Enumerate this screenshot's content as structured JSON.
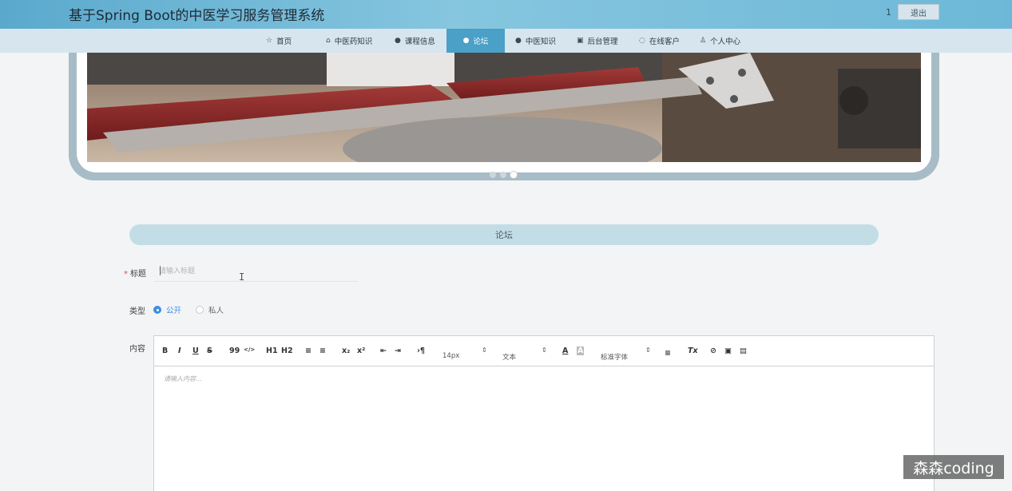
{
  "header": {
    "site_title": "基于Spring Boot的中医学习服务管理系统",
    "user_num": "1",
    "logout_label": "退出"
  },
  "nav": {
    "items": [
      {
        "label": "首页",
        "icon": "star-icon",
        "glyph": "☆"
      },
      {
        "label": "中医药知识",
        "icon": "bag-icon",
        "glyph": "⌂"
      },
      {
        "label": "课程信息",
        "icon": "info-icon",
        "glyph": "●"
      },
      {
        "label": "论坛",
        "icon": "question-icon",
        "glyph": "●"
      },
      {
        "label": "中医知识",
        "icon": "info-icon",
        "glyph": "●"
      },
      {
        "label": "后台管理",
        "icon": "briefcase-icon",
        "glyph": "▣"
      },
      {
        "label": "在线客户",
        "icon": "headset-icon",
        "glyph": "◌"
      },
      {
        "label": "个人中心",
        "icon": "user-icon",
        "glyph": "♙"
      }
    ],
    "active_index": 3
  },
  "carousel": {
    "slide_count": 3,
    "active_slide": 3
  },
  "section": {
    "title": "论坛"
  },
  "form": {
    "title_label": "标题",
    "required_mark": "*",
    "title_placeholder": "请输入标题",
    "type_label": "类型",
    "type_options": [
      "公开",
      "私人"
    ],
    "type_selected": "公开",
    "content_label": "内容",
    "content_placeholder": "请输入内容..."
  },
  "editor_toolbar": {
    "bold": "B",
    "italic": "I",
    "underline": "U",
    "strike": "S",
    "quote": "99",
    "code": "</>",
    "h1": "H1",
    "h2": "H2",
    "ordered_list": "≡",
    "bullet_list": "≡",
    "subscript": "x₂",
    "superscript": "x²",
    "outdent": "⇤",
    "indent": "⇥",
    "direction": "›¶",
    "font_size": "14px",
    "text_style": "文本",
    "font_family": "标准字体",
    "color_icon": "A",
    "background_icon": "A",
    "align_icon": "≡",
    "clean_icon": "Tx",
    "link_icon": "⊘",
    "image_icon": "▣",
    "video_icon": "▤",
    "dropdown_arrow": "⇕"
  },
  "watermark": {
    "text": "森森coding"
  },
  "colors": {
    "header_bg": "#6db8d8",
    "nav_bg": "#d6e5ee",
    "nav_active": "#4aa0c6",
    "section_bar": "#c3dde6",
    "radio_active": "#3a8ee6"
  }
}
